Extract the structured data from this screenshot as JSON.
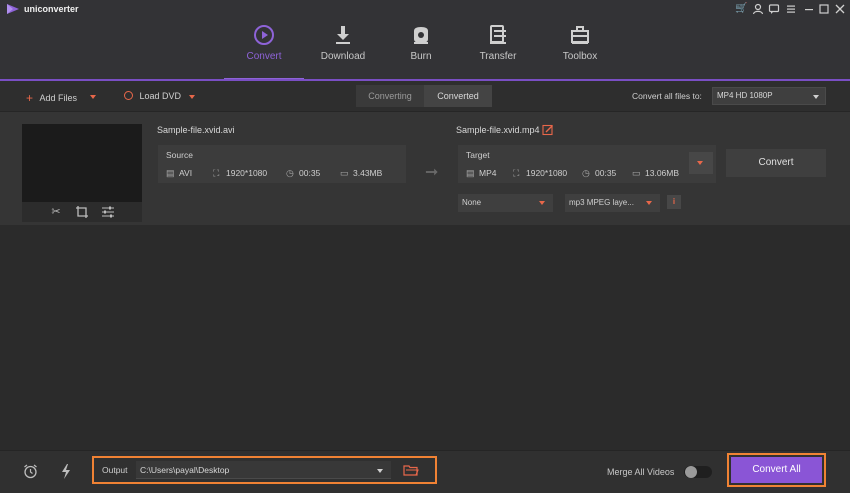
{
  "app": {
    "name": "uniconverter"
  },
  "nav": {
    "tabs": [
      {
        "label": "Convert",
        "icon": "play-circle-icon",
        "active": true
      },
      {
        "label": "Download",
        "icon": "download-icon",
        "active": false
      },
      {
        "label": "Burn",
        "icon": "disc-icon",
        "active": false
      },
      {
        "label": "Transfer",
        "icon": "transfer-icon",
        "active": false
      },
      {
        "label": "Toolbox",
        "icon": "toolbox-icon",
        "active": false
      }
    ]
  },
  "toolbar": {
    "add_files": "Add Files",
    "load_dvd": "Load DVD",
    "segments": {
      "converting": "Converting",
      "converted": "Converted"
    },
    "convert_all_to_label": "Convert all files to:",
    "convert_all_to_value": "MP4 HD 1080P"
  },
  "file": {
    "source_name": "Sample-file.xvid.avi",
    "target_name": "Sample-file.xvid.mp4",
    "source": {
      "header": "Source",
      "format": "AVI",
      "resolution": "1920*1080",
      "duration": "00:35",
      "size": "3.43MB"
    },
    "target": {
      "header": "Target",
      "format": "MP4",
      "resolution": "1920*1080",
      "duration": "00:35",
      "size": "13.06MB"
    },
    "convert_button": "Convert",
    "subtitle_select": "None",
    "audio_select": "mp3 MPEG laye...",
    "info_button": "i"
  },
  "footer": {
    "output_label": "Output",
    "output_path": "C:\\Users\\payal\\Desktop",
    "merge_label": "Merge All Videos",
    "merge_enabled": false,
    "convert_all_button": "Convert All"
  },
  "colors": {
    "accent": "#8a55d6",
    "highlight": "#f08234",
    "icon_red": "#e8674a"
  }
}
